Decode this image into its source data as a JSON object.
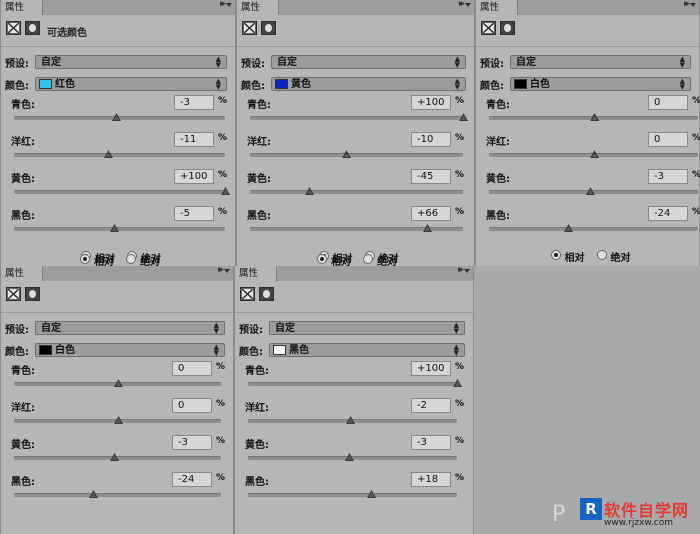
{
  "tab_label": "属性",
  "icon_title": "可选颜色",
  "preset_label": "预设:",
  "preset_value": "自定",
  "colors_label": "颜色:",
  "slider_labels": [
    "青色:",
    "洋红:",
    "黄色:",
    "黑色:"
  ],
  "pct": "%",
  "radio_relative": "相对",
  "radio_absolute": "绝对",
  "panels": [
    {
      "color_name": "红色",
      "swatch": "#2ec4f0",
      "values": [
        "-3",
        "-11",
        "+100",
        "-5"
      ],
      "relative_selected": true
    },
    {
      "color_name": "黄色",
      "swatch": "#1020c8",
      "values": [
        "+100",
        "-10",
        "-45",
        "+66"
      ],
      "relative_selected": true
    },
    {
      "color_name": "白色",
      "swatch": "#000000",
      "values": [
        "0",
        "0",
        "-3",
        "-24"
      ],
      "relative_selected": true
    },
    {
      "color_name": "白色",
      "swatch": "#000000",
      "values": [
        "0",
        "0",
        "-3",
        "-24"
      ],
      "relative_selected": true
    },
    {
      "color_name": "黑色",
      "swatch": "#ffffff",
      "values": [
        "+100",
        "-2",
        "-3",
        "+18"
      ],
      "relative_selected": true
    }
  ],
  "watermark": {
    "ps": "P",
    "logo_letter": "R",
    "site_name": "软件自学网",
    "url": "www.rjzxw.com"
  }
}
